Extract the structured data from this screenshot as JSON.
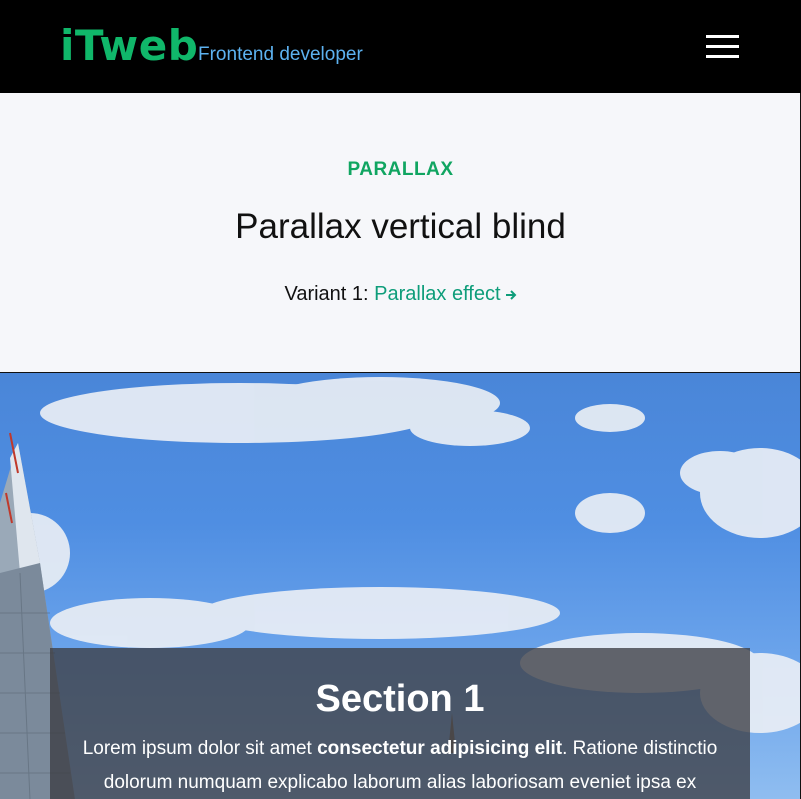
{
  "header": {
    "logo": "iTweb",
    "tagline": "Frontend developer"
  },
  "intro": {
    "kicker": "PARALLAX",
    "title": "Parallax vertical blind",
    "variant_prefix": "Variant 1: ",
    "variant_link": "Parallax effect"
  },
  "section": {
    "title": "Section 1",
    "text_before": "Lorem ipsum dolor sit amet ",
    "text_bold": "consectetur adipisicing elit",
    "text_after": ". Ratione distinctio dolorum numquam explicabo laborum alias laboriosam eveniet ipsa ex"
  },
  "colors": {
    "brand_green": "#10b76a",
    "tagline_blue": "#5db2f0",
    "link_teal": "#0e9d7a"
  }
}
